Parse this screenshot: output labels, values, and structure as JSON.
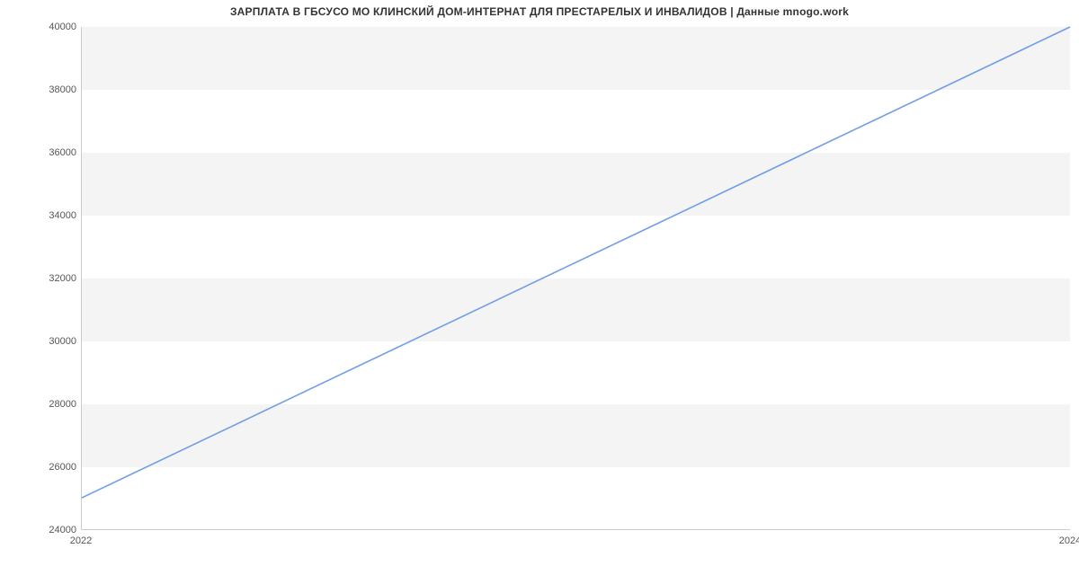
{
  "chart_data": {
    "type": "line",
    "title": "ЗАРПЛАТА В ГБСУСО МО КЛИНСКИЙ ДОМ-ИНТЕРНАТ ДЛЯ ПРЕСТАРЕЛЫХ И ИНВАЛИДОВ | Данные mnogo.work",
    "xlabel": "",
    "ylabel": "",
    "x": [
      2022,
      2024
    ],
    "values": [
      25000,
      40000
    ],
    "xlim": [
      2022,
      2024
    ],
    "ylim": [
      24000,
      40000
    ],
    "yticks": [
      24000,
      26000,
      28000,
      30000,
      32000,
      34000,
      36000,
      38000,
      40000
    ],
    "xticks": [
      2022,
      2024
    ],
    "line_color": "#6f9ee8",
    "band_color": "#f4f4f4"
  }
}
